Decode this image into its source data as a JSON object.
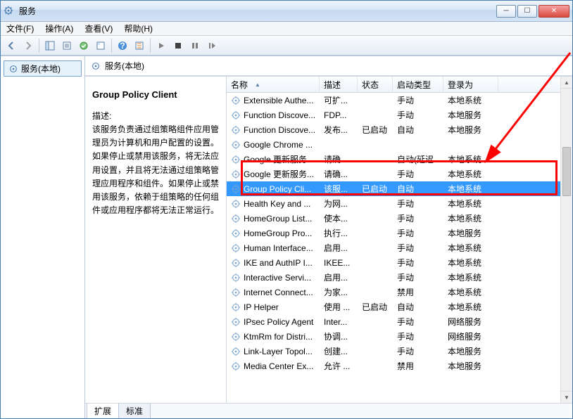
{
  "window": {
    "title": "服务"
  },
  "menu": {
    "file": "文件(F)",
    "action": "操作(A)",
    "view": "查看(V)",
    "help": "帮助(H)"
  },
  "tree": {
    "root": "服务(本地)"
  },
  "main": {
    "heading": "服务(本地)"
  },
  "detail": {
    "title": "Group Policy Client",
    "desc_label": "描述:",
    "desc": "该服务负责通过组策略组件应用管理员为计算机和用户配置的设置。如果停止或禁用该服务，将无法应用设置，并且将无法通过组策略管理应用程序和组件。如果停止或禁用该服务，依赖于组策略的任何组件或应用程序都将无法正常运行。"
  },
  "columns": {
    "name": "名称",
    "desc": "描述",
    "status": "状态",
    "startup": "启动类型",
    "logon": "登录为"
  },
  "rows": [
    {
      "name": "Extensible Authe...",
      "desc": "可扩...",
      "status": "",
      "startup": "手动",
      "logon": "本地系统"
    },
    {
      "name": "Function Discove...",
      "desc": "FDP...",
      "status": "",
      "startup": "手动",
      "logon": "本地服务"
    },
    {
      "name": "Function Discove...",
      "desc": "发布...",
      "status": "已启动",
      "startup": "自动",
      "logon": "本地服务"
    },
    {
      "name": "Google Chrome ...",
      "desc": "",
      "status": "",
      "startup": "",
      "logon": ""
    },
    {
      "name": "Google 更新服务...",
      "desc": "请确...",
      "status": "",
      "startup": "自动(延迟...",
      "logon": "本地系统"
    },
    {
      "name": "Google 更新服务...",
      "desc": "请确...",
      "status": "",
      "startup": "手动",
      "logon": "本地系统"
    },
    {
      "name": "Group Policy Cli...",
      "desc": "该服...",
      "status": "已启动",
      "startup": "自动",
      "logon": "本地系统",
      "selected": true
    },
    {
      "name": "Health Key and ...",
      "desc": "为网...",
      "status": "",
      "startup": "手动",
      "logon": "本地系统"
    },
    {
      "name": "HomeGroup List...",
      "desc": "使本...",
      "status": "",
      "startup": "手动",
      "logon": "本地系统"
    },
    {
      "name": "HomeGroup Pro...",
      "desc": "执行...",
      "status": "",
      "startup": "手动",
      "logon": "本地服务"
    },
    {
      "name": "Human Interface...",
      "desc": "启用...",
      "status": "",
      "startup": "手动",
      "logon": "本地系统"
    },
    {
      "name": "IKE and AuthIP I...",
      "desc": "IKEE...",
      "status": "",
      "startup": "手动",
      "logon": "本地系统"
    },
    {
      "name": "Interactive Servi...",
      "desc": "启用...",
      "status": "",
      "startup": "手动",
      "logon": "本地系统"
    },
    {
      "name": "Internet Connect...",
      "desc": "为家...",
      "status": "",
      "startup": "禁用",
      "logon": "本地系统"
    },
    {
      "name": "IP Helper",
      "desc": "使用 ...",
      "status": "已启动",
      "startup": "自动",
      "logon": "本地系统"
    },
    {
      "name": "IPsec Policy Agent",
      "desc": "Inter...",
      "status": "",
      "startup": "手动",
      "logon": "网络服务"
    },
    {
      "name": "KtmRm for Distri...",
      "desc": "协调...",
      "status": "",
      "startup": "手动",
      "logon": "网络服务"
    },
    {
      "name": "Link-Layer Topol...",
      "desc": "创建...",
      "status": "",
      "startup": "手动",
      "logon": "本地服务"
    },
    {
      "name": "Media Center Ex...",
      "desc": "允许 ...",
      "status": "",
      "startup": "禁用",
      "logon": "本地服务"
    }
  ],
  "tabs": {
    "extended": "扩展",
    "standard": "标准"
  }
}
